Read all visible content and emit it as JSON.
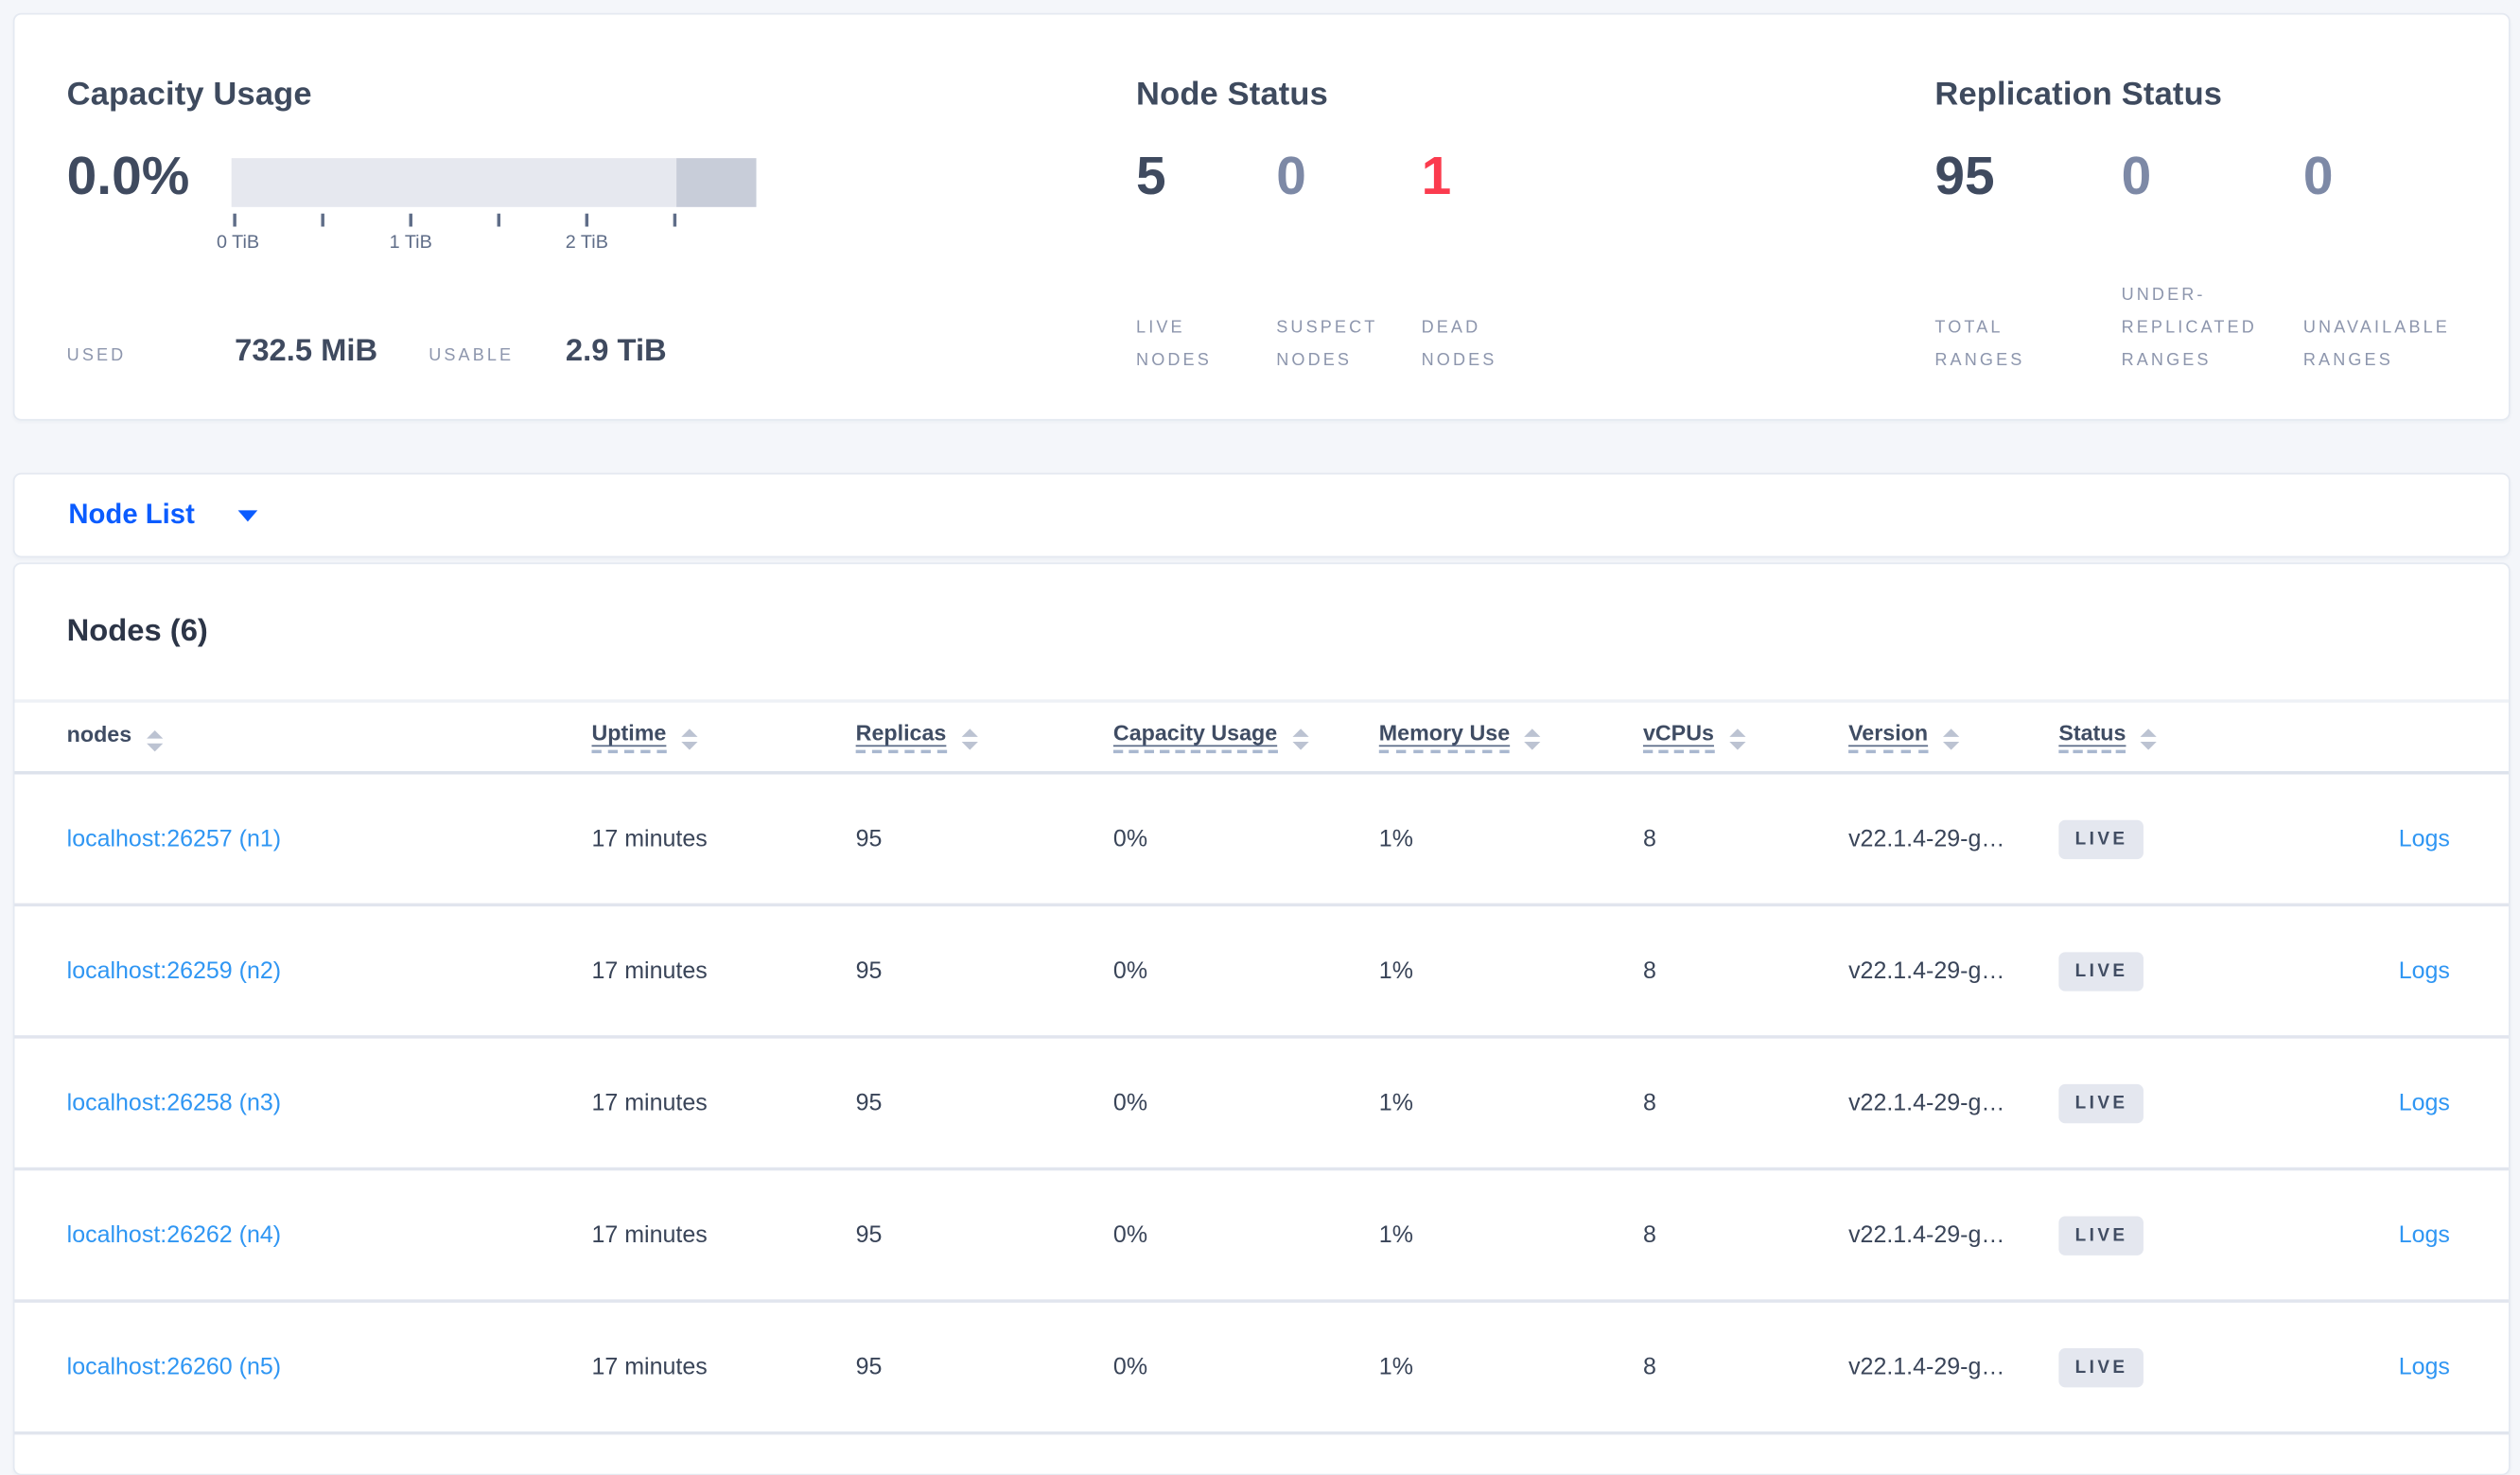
{
  "colors": {
    "page_bg": "#f4f6fa",
    "stat_dark": "#3f4a5f",
    "stat_muted": "#7d89a6",
    "stat_dead_red": "#fb3b4e",
    "primary_link_blue": "#0b5cff",
    "table_link_blue": "#2f96f3",
    "bar_light": "#e6e8ef",
    "bar_dark": "#c8cdd9",
    "badge_bg": "#e4e7ef"
  },
  "summary": {
    "capacity": {
      "title": "Capacity Usage",
      "percent": "0.0%",
      "axis_ticks": [
        "0 TiB",
        "1 TiB",
        "2 TiB"
      ],
      "used_label": "USED",
      "used_value": "732.5 MiB",
      "usable_label": "USABLE",
      "usable_value": "2.9 TiB"
    },
    "node_status": {
      "title": "Node Status",
      "stats": [
        {
          "value": "5",
          "label": "LIVE NODES",
          "color": "#3f4a5f"
        },
        {
          "value": "0",
          "label": "SUSPECT NODES",
          "color": "#7d89a6"
        },
        {
          "value": "1",
          "label": "DEAD NODES",
          "color": "#fb3b4e"
        }
      ]
    },
    "replication_status": {
      "title": "Replication Status",
      "stats": [
        {
          "value": "95",
          "label": "TOTAL RANGES",
          "color": "#3f4a5f"
        },
        {
          "value": "0",
          "label": "UNDER-REPLICATED RANGES",
          "color": "#7d89a6"
        },
        {
          "value": "0",
          "label": "UNAVAILABLE RANGES",
          "color": "#7d89a6"
        }
      ]
    }
  },
  "node_list_dropdown": {
    "label": "Node List"
  },
  "nodes_section": {
    "heading": "Nodes (6)",
    "columns": [
      {
        "label": "nodes"
      },
      {
        "label": "Uptime"
      },
      {
        "label": "Replicas"
      },
      {
        "label": "Capacity Usage"
      },
      {
        "label": "Memory Use"
      },
      {
        "label": "vCPUs"
      },
      {
        "label": "Version"
      },
      {
        "label": "Status"
      }
    ],
    "rows": [
      {
        "name": "localhost:26257 (n1)",
        "uptime": "17 minutes",
        "replicas": "95",
        "capacity": "0%",
        "memory": "1%",
        "vcpus": "8",
        "version": "v22.1.4-29-g…",
        "status": "LIVE",
        "logs": "Logs"
      },
      {
        "name": "localhost:26259 (n2)",
        "uptime": "17 minutes",
        "replicas": "95",
        "capacity": "0%",
        "memory": "1%",
        "vcpus": "8",
        "version": "v22.1.4-29-g…",
        "status": "LIVE",
        "logs": "Logs"
      },
      {
        "name": "localhost:26258 (n3)",
        "uptime": "17 minutes",
        "replicas": "95",
        "capacity": "0%",
        "memory": "1%",
        "vcpus": "8",
        "version": "v22.1.4-29-g…",
        "status": "LIVE",
        "logs": "Logs"
      },
      {
        "name": "localhost:26262 (n4)",
        "uptime": "17 minutes",
        "replicas": "95",
        "capacity": "0%",
        "memory": "1%",
        "vcpus": "8",
        "version": "v22.1.4-29-g…",
        "status": "LIVE",
        "logs": "Logs"
      },
      {
        "name": "localhost:26260 (n5)",
        "uptime": "17 minutes",
        "replicas": "95",
        "capacity": "0%",
        "memory": "1%",
        "vcpus": "8",
        "version": "v22.1.4-29-g…",
        "status": "LIVE",
        "logs": "Logs"
      }
    ]
  }
}
